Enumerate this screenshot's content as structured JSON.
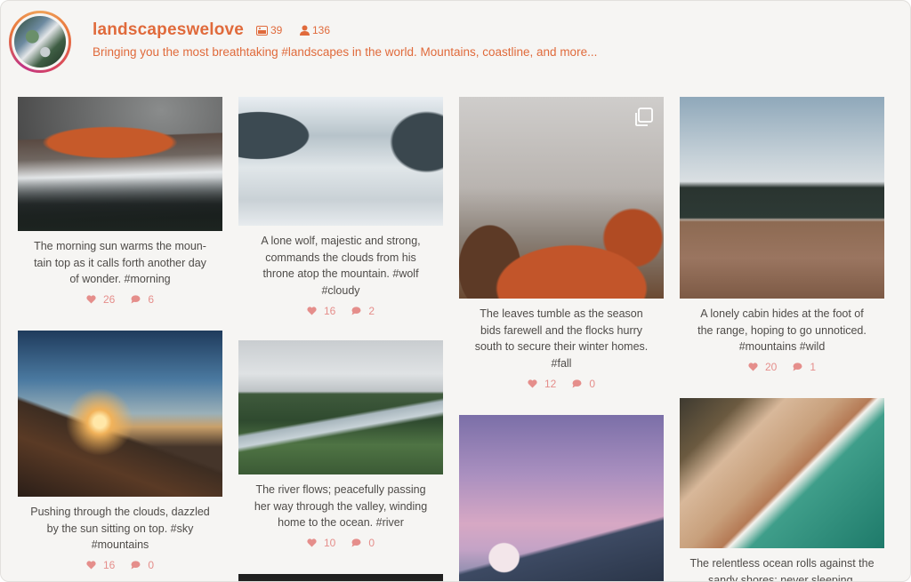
{
  "profile": {
    "username": "landscapeswelove",
    "posts_count": "39",
    "followers_count": "136",
    "bio": "Bringing you the most breathtaking #landscapes in the world. Mountains, coastline, and more..."
  },
  "colors": {
    "accent": "#e06a3b",
    "meta": "#e58e8b",
    "caption": "#4e4b48",
    "background": "#f6f5f3"
  },
  "icons": {
    "posts": "image-icon",
    "followers": "user-icon",
    "likes": "heart-icon",
    "comments": "comment-icon",
    "gallery": "multiple-images-icon"
  },
  "posts": [
    {
      "caption": "The morning sun warms the mountain top as it calls forth another day of wonder. #morning",
      "caption_lines": [
        "The morning sun warms the moun-",
        "tain top as it calls forth another day",
        "of wonder. #morning"
      ],
      "likes": "26",
      "comments": "6"
    },
    {
      "caption": "A lone wolf, majestic and strong, commands the clouds from his throne atop the mountain. #wolf #cloudy",
      "caption_lines": [
        "A lone wolf, majestic and strong,",
        "commands the clouds from his",
        "throne atop the mountain. #wolf",
        "#cloudy"
      ],
      "likes": "16",
      "comments": "2"
    },
    {
      "caption": "The leaves tumble as the season bids farewell and the flocks hurry south to secure their winter homes. #fall",
      "caption_lines": [
        "The leaves tumble as the season",
        "bids farewell and the flocks hurry",
        "south to secure their winter homes.",
        "#fall"
      ],
      "likes": "12",
      "comments": "0"
    },
    {
      "caption": "A lonely cabin hides at the foot of the range, hoping to go unnoticed. #mountains #wild",
      "caption_lines": [
        "A lonely cabin hides at the foot of",
        "the range, hoping to go unnoticed.",
        "#mountains #wild"
      ],
      "likes": "20",
      "comments": "1"
    },
    {
      "caption": "Pushing through the clouds, dazzled by the sun sitting on top. #sky #mountains",
      "caption_lines": [
        "Pushing through the clouds, dazzled",
        "by the sun sitting on top. #sky",
        "#mountains"
      ],
      "likes": "16",
      "comments": "0"
    },
    {
      "caption": "The river flows; peacefully passing her way through the valley, winding home to the ocean. #river",
      "caption_lines": [
        "The river flows; peacefully passing",
        "her way through the valley, winding",
        "home to the ocean. #river"
      ],
      "likes": "10",
      "comments": "0"
    },
    {
      "caption": "The relentless ocean rolls against the sandy shores; never sleeping.",
      "caption_lines": [
        "The relentless ocean rolls against the",
        "sandy shores; never sleeping."
      ],
      "likes": "",
      "comments": ""
    }
  ]
}
